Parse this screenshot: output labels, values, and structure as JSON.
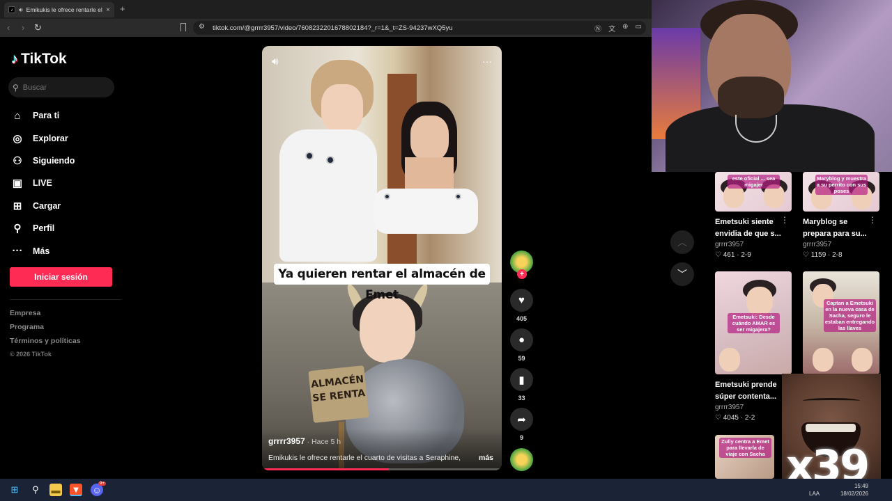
{
  "browser": {
    "tab_title": "Emikukis le ofrece rentarle el",
    "tab_close": "×",
    "new_tab": "+",
    "url": "tiktok.com/@grrrr3957/video/7608232201678802184?_r=1&_t=ZS-94237wXQ5yu"
  },
  "sidebar": {
    "brand": "TikTok",
    "search_placeholder": "Buscar",
    "nav": [
      {
        "label": "Para ti",
        "icon": "home-icon",
        "glyph": "⌂"
      },
      {
        "label": "Explorar",
        "icon": "compass-icon",
        "glyph": "◎"
      },
      {
        "label": "Siguiendo",
        "icon": "following-icon",
        "glyph": "⚇"
      },
      {
        "label": "LIVE",
        "icon": "live-icon",
        "glyph": "▣"
      },
      {
        "label": "Cargar",
        "icon": "upload-icon",
        "glyph": "⊞"
      },
      {
        "label": "Perfil",
        "icon": "profile-icon",
        "glyph": "⚲"
      },
      {
        "label": "Más",
        "icon": "more-icon",
        "glyph": "···"
      }
    ],
    "login_label": "Iniciar sesión",
    "footer": [
      "Empresa",
      "Programa",
      "Términos y políticas"
    ],
    "copyright": "© 2026 TikTok"
  },
  "video": {
    "caption_overlay": "Ya quieren rentar el almacén de Emet",
    "sign_text_1": "ALMACÉN",
    "sign_text_2": "SE RENTA",
    "author": "grrrr3957",
    "time_ago": " · Hace 5 h",
    "description": "Emikukis le ofrece rentarle el cuarto de visitas a Seraphine,",
    "more_label": "más",
    "progress": 0.53
  },
  "actions": {
    "follow_plus": "+",
    "likes": "405",
    "comments": "59",
    "saves": "33",
    "shares": "9"
  },
  "recommendations": [
    {
      "overlay": "este oficial ... sea migajer",
      "title": "Emetsuki siente envidia de que s...",
      "user": "grrrr3957",
      "likes": "461",
      "date": "2-9"
    },
    {
      "overlay": "Maryblog y muestra a su perrito con sus poses",
      "title": "Maryblog se prepara para su...",
      "user": "grrrr3957",
      "likes": "1159",
      "date": "2-8"
    },
    {
      "overlay": "Emetsuki: Desde cuándo AMAR es ser migajera?",
      "title": "Emetsuki prende súper contenta...",
      "user": "grrrr3957",
      "likes": "4045",
      "date": "2-2"
    },
    {
      "overlay": "Captan a Emetsuki en la nueva casa de Sacha, seguro le estaban entregando las llaves",
      "title": "",
      "user": "",
      "likes": "",
      "date": ""
    },
    {
      "overlay": "Zully centra a Emet para llevarla de viaje con Sacha",
      "title": "",
      "user": "",
      "likes": "",
      "date": ""
    }
  ],
  "meme": {
    "multiplier": "x39"
  },
  "taskbar": {
    "time": "15:49",
    "date": "18/02/2026",
    "lang": "LAA",
    "discord_badge": "9+"
  },
  "colors": {
    "accent": "#fe2c55",
    "background": "#000000",
    "taskbar": "#1b2436"
  }
}
